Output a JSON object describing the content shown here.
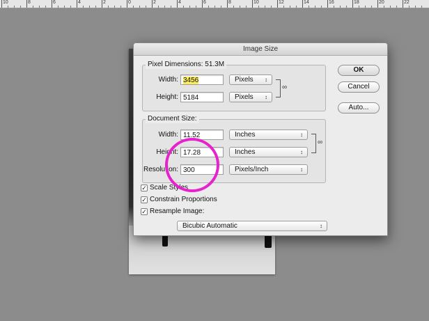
{
  "ruler": {
    "labels": [
      "10",
      "8",
      "6",
      "4",
      "2",
      "0",
      "2",
      "4",
      "6",
      "8",
      "10",
      "12",
      "14",
      "16",
      "18",
      "20",
      "22"
    ]
  },
  "dialog": {
    "title": "Image Size",
    "pixel_dimensions": {
      "title": "Pixel Dimensions:  51.3M",
      "width_label": "Width:",
      "width_value": "3456",
      "width_unit": "Pixels",
      "height_label": "Height:",
      "height_value": "5184",
      "height_unit": "Pixels"
    },
    "document_size": {
      "title": "Document Size:",
      "width_label": "Width:",
      "width_value": "11.52",
      "width_unit": "Inches",
      "height_label": "Height:",
      "height_value": "17.28",
      "height_unit": "Inches",
      "resolution_label": "Resolution:",
      "resolution_value": "300",
      "resolution_unit": "Pixels/Inch"
    },
    "options": {
      "scale_styles": "Scale Styles",
      "constrain_proportions": "Constrain Proportions",
      "resample_image": "Resample Image:",
      "resample_method": "Bicubic Automatic"
    },
    "buttons": {
      "ok": "OK",
      "cancel": "Cancel",
      "auto": "Auto..."
    }
  },
  "annotation": {
    "color": "#e522cc"
  }
}
